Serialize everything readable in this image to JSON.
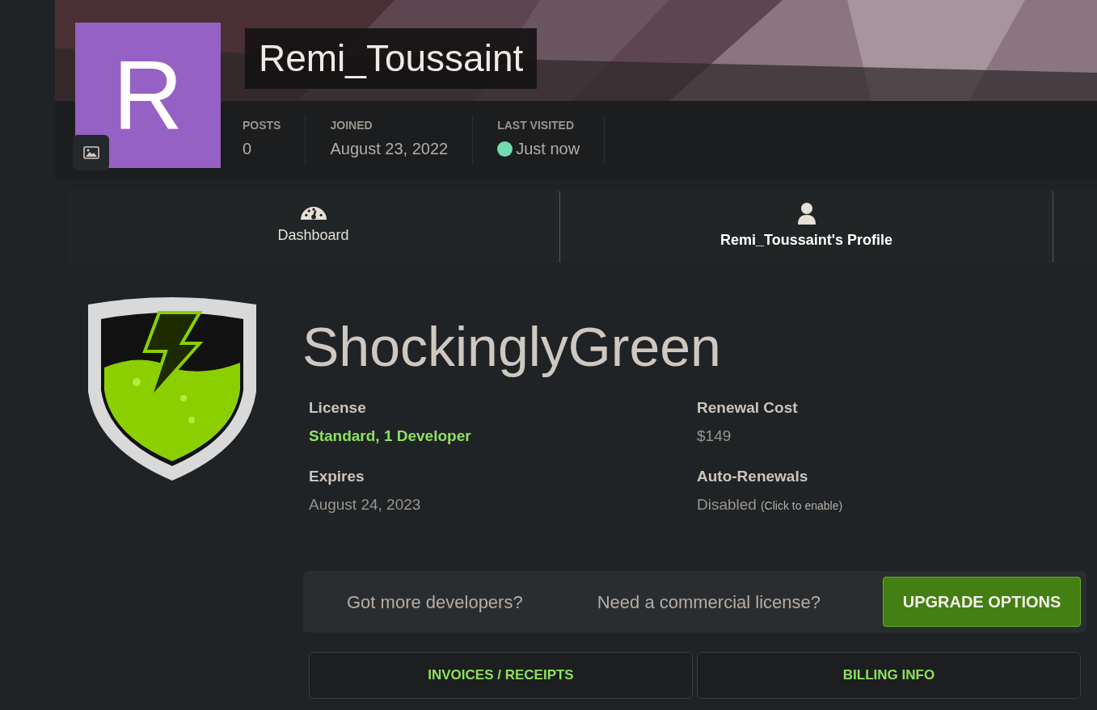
{
  "profile": {
    "avatar_letter": "R",
    "username": "Remi_Toussaint",
    "stats": [
      {
        "label": "POSTS",
        "value": "0",
        "online": false
      },
      {
        "label": "JOINED",
        "value": "August 23, 2022",
        "online": false
      },
      {
        "label": "LAST VISITED",
        "value": "Just now",
        "online": true
      }
    ]
  },
  "tabs": [
    {
      "label": "Dashboard",
      "kind": "dashboard",
      "selected": false
    },
    {
      "label": "Remi_Toussaint's Profile",
      "kind": "profile",
      "selected": true
    }
  ],
  "product": {
    "title": "ShockinglyGreen",
    "fields": [
      {
        "label": "License",
        "value": "Standard, 1 Developer",
        "kind": "highlight"
      },
      {
        "label": "Renewal Cost",
        "value": "$149",
        "kind": "plain"
      },
      {
        "label": "Expires",
        "value": "August 24, 2023",
        "kind": "plain"
      },
      {
        "label": "Auto-Renewals",
        "value": "Disabled",
        "hint": "(Click to enable)",
        "kind": "plain"
      }
    ]
  },
  "promo": {
    "texts": [
      "Got more developers?",
      "Need a commercial license?"
    ],
    "button": "UPGRADE OPTIONS"
  },
  "actions": [
    "INVOICES / RECEIPTS",
    "BILLING INFO"
  ]
}
